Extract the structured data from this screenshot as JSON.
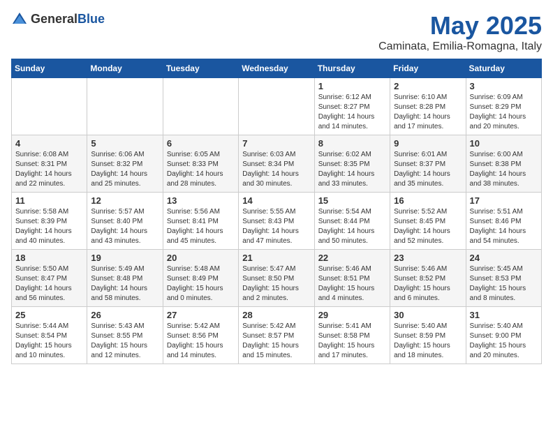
{
  "header": {
    "logo_general": "General",
    "logo_blue": "Blue",
    "month": "May 2025",
    "location": "Caminata, Emilia-Romagna, Italy"
  },
  "weekdays": [
    "Sunday",
    "Monday",
    "Tuesday",
    "Wednesday",
    "Thursday",
    "Friday",
    "Saturday"
  ],
  "weeks": [
    [
      {
        "day": "",
        "info": ""
      },
      {
        "day": "",
        "info": ""
      },
      {
        "day": "",
        "info": ""
      },
      {
        "day": "",
        "info": ""
      },
      {
        "day": "1",
        "info": "Sunrise: 6:12 AM\nSunset: 8:27 PM\nDaylight: 14 hours\nand 14 minutes."
      },
      {
        "day": "2",
        "info": "Sunrise: 6:10 AM\nSunset: 8:28 PM\nDaylight: 14 hours\nand 17 minutes."
      },
      {
        "day": "3",
        "info": "Sunrise: 6:09 AM\nSunset: 8:29 PM\nDaylight: 14 hours\nand 20 minutes."
      }
    ],
    [
      {
        "day": "4",
        "info": "Sunrise: 6:08 AM\nSunset: 8:31 PM\nDaylight: 14 hours\nand 22 minutes."
      },
      {
        "day": "5",
        "info": "Sunrise: 6:06 AM\nSunset: 8:32 PM\nDaylight: 14 hours\nand 25 minutes."
      },
      {
        "day": "6",
        "info": "Sunrise: 6:05 AM\nSunset: 8:33 PM\nDaylight: 14 hours\nand 28 minutes."
      },
      {
        "day": "7",
        "info": "Sunrise: 6:03 AM\nSunset: 8:34 PM\nDaylight: 14 hours\nand 30 minutes."
      },
      {
        "day": "8",
        "info": "Sunrise: 6:02 AM\nSunset: 8:35 PM\nDaylight: 14 hours\nand 33 minutes."
      },
      {
        "day": "9",
        "info": "Sunrise: 6:01 AM\nSunset: 8:37 PM\nDaylight: 14 hours\nand 35 minutes."
      },
      {
        "day": "10",
        "info": "Sunrise: 6:00 AM\nSunset: 8:38 PM\nDaylight: 14 hours\nand 38 minutes."
      }
    ],
    [
      {
        "day": "11",
        "info": "Sunrise: 5:58 AM\nSunset: 8:39 PM\nDaylight: 14 hours\nand 40 minutes."
      },
      {
        "day": "12",
        "info": "Sunrise: 5:57 AM\nSunset: 8:40 PM\nDaylight: 14 hours\nand 43 minutes."
      },
      {
        "day": "13",
        "info": "Sunrise: 5:56 AM\nSunset: 8:41 PM\nDaylight: 14 hours\nand 45 minutes."
      },
      {
        "day": "14",
        "info": "Sunrise: 5:55 AM\nSunset: 8:43 PM\nDaylight: 14 hours\nand 47 minutes."
      },
      {
        "day": "15",
        "info": "Sunrise: 5:54 AM\nSunset: 8:44 PM\nDaylight: 14 hours\nand 50 minutes."
      },
      {
        "day": "16",
        "info": "Sunrise: 5:52 AM\nSunset: 8:45 PM\nDaylight: 14 hours\nand 52 minutes."
      },
      {
        "day": "17",
        "info": "Sunrise: 5:51 AM\nSunset: 8:46 PM\nDaylight: 14 hours\nand 54 minutes."
      }
    ],
    [
      {
        "day": "18",
        "info": "Sunrise: 5:50 AM\nSunset: 8:47 PM\nDaylight: 14 hours\nand 56 minutes."
      },
      {
        "day": "19",
        "info": "Sunrise: 5:49 AM\nSunset: 8:48 PM\nDaylight: 14 hours\nand 58 minutes."
      },
      {
        "day": "20",
        "info": "Sunrise: 5:48 AM\nSunset: 8:49 PM\nDaylight: 15 hours\nand 0 minutes."
      },
      {
        "day": "21",
        "info": "Sunrise: 5:47 AM\nSunset: 8:50 PM\nDaylight: 15 hours\nand 2 minutes."
      },
      {
        "day": "22",
        "info": "Sunrise: 5:46 AM\nSunset: 8:51 PM\nDaylight: 15 hours\nand 4 minutes."
      },
      {
        "day": "23",
        "info": "Sunrise: 5:46 AM\nSunset: 8:52 PM\nDaylight: 15 hours\nand 6 minutes."
      },
      {
        "day": "24",
        "info": "Sunrise: 5:45 AM\nSunset: 8:53 PM\nDaylight: 15 hours\nand 8 minutes."
      }
    ],
    [
      {
        "day": "25",
        "info": "Sunrise: 5:44 AM\nSunset: 8:54 PM\nDaylight: 15 hours\nand 10 minutes."
      },
      {
        "day": "26",
        "info": "Sunrise: 5:43 AM\nSunset: 8:55 PM\nDaylight: 15 hours\nand 12 minutes."
      },
      {
        "day": "27",
        "info": "Sunrise: 5:42 AM\nSunset: 8:56 PM\nDaylight: 15 hours\nand 14 minutes."
      },
      {
        "day": "28",
        "info": "Sunrise: 5:42 AM\nSunset: 8:57 PM\nDaylight: 15 hours\nand 15 minutes."
      },
      {
        "day": "29",
        "info": "Sunrise: 5:41 AM\nSunset: 8:58 PM\nDaylight: 15 hours\nand 17 minutes."
      },
      {
        "day": "30",
        "info": "Sunrise: 5:40 AM\nSunset: 8:59 PM\nDaylight: 15 hours\nand 18 minutes."
      },
      {
        "day": "31",
        "info": "Sunrise: 5:40 AM\nSunset: 9:00 PM\nDaylight: 15 hours\nand 20 minutes."
      }
    ]
  ]
}
